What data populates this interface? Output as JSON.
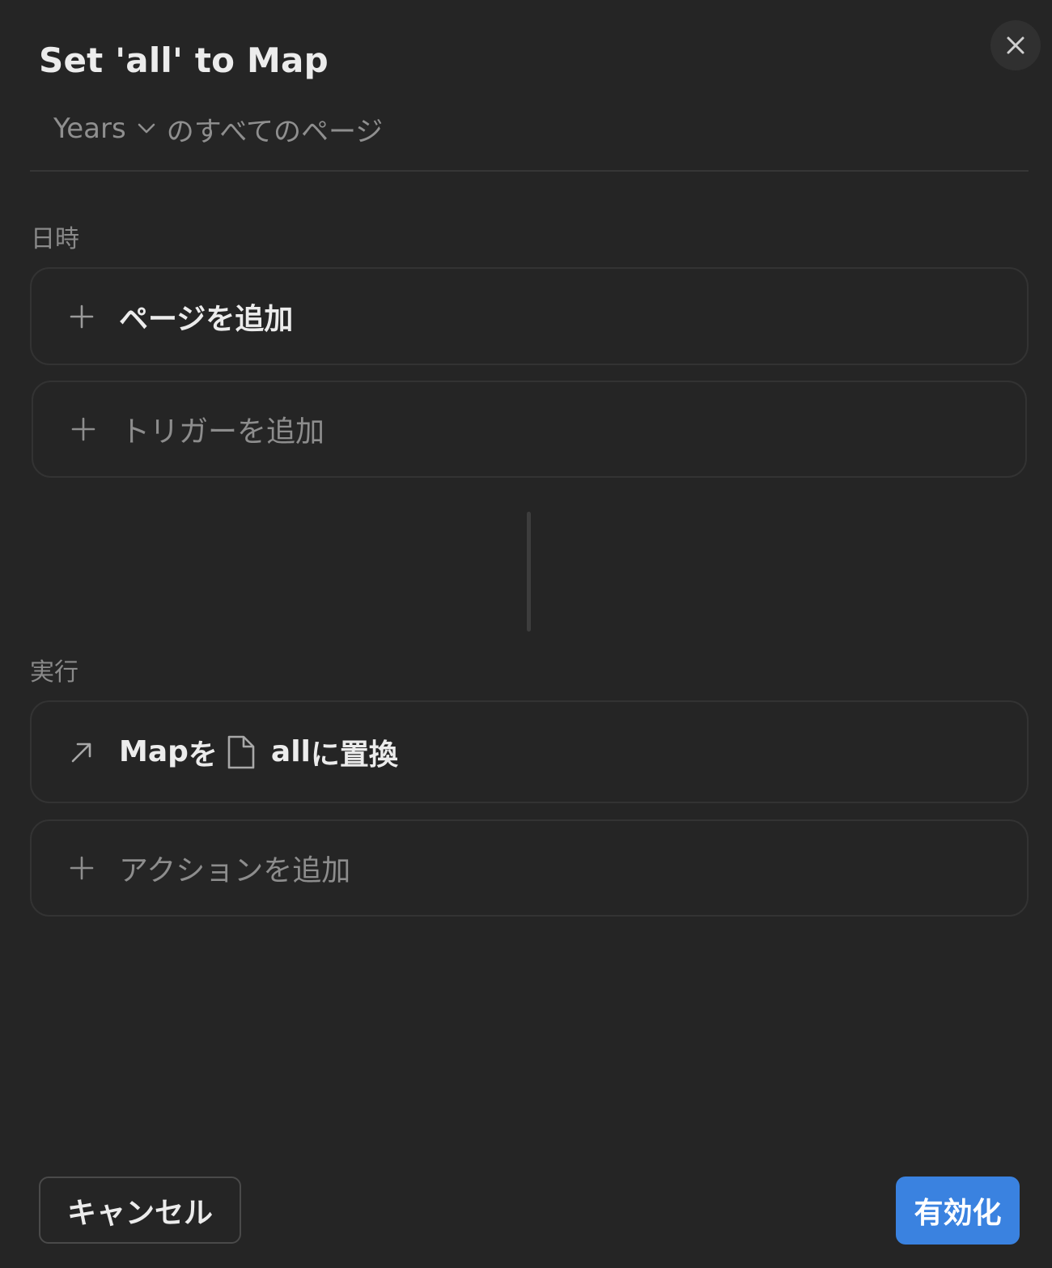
{
  "dialog": {
    "title": "Set 'all' to Map",
    "scope": {
      "database_label": "Years",
      "suffix": "のすべてのページ"
    }
  },
  "trigger_section": {
    "label": "日時",
    "add_page_label": "ページを追加",
    "add_trigger_label": "トリガーを追加"
  },
  "action_section": {
    "label": "実行",
    "action": {
      "property": "Map",
      "particle": "を",
      "value": "all",
      "verb": "に置換"
    },
    "add_action_label": "アクションを追加"
  },
  "footer": {
    "cancel_label": "キャンセル",
    "enable_label": "有効化"
  },
  "colors": {
    "background": "#252525",
    "accent": "#3a82e0",
    "muted_text": "#8d8d8d",
    "border": "#333333"
  },
  "icons": {
    "close": "close-icon",
    "chevron": "chevron-down-icon",
    "add": "plus-icon",
    "action": "arrow-up-right-icon",
    "page": "document-icon"
  }
}
